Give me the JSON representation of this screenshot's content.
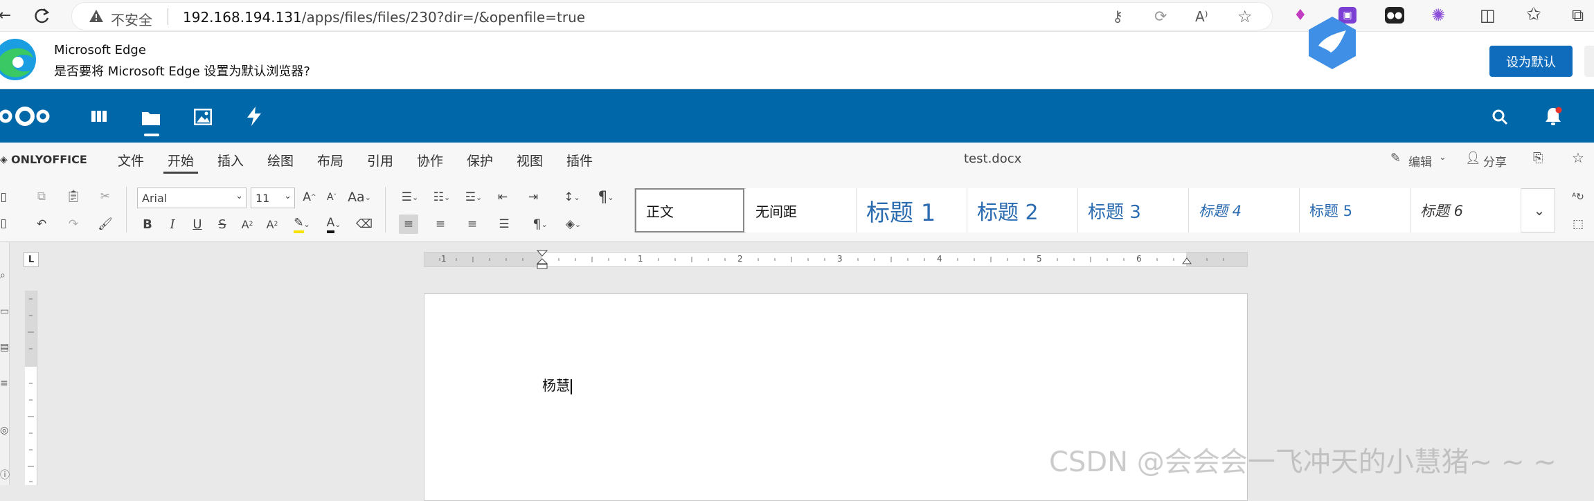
{
  "browser": {
    "insecure_label": "不安全",
    "url_host": "192.168.194.131",
    "url_path": "/apps/files/files/230?dir=/&openfile=true"
  },
  "infobar": {
    "title": "Microsoft Edge",
    "message": "是否要将 Microsoft Edge 设置为默认浏览器?",
    "button": "设为默认"
  },
  "onlyoffice": {
    "brand": "ONLYOFFICE",
    "menu": [
      "文件",
      "开始",
      "插入",
      "绘图",
      "布局",
      "引用",
      "协作",
      "保护",
      "视图",
      "插件"
    ],
    "active_tab": "开始",
    "doc_title": "test.docx",
    "edit_label": "编辑",
    "share_label": "分享"
  },
  "toolbar": {
    "font_name": "Arial",
    "font_size": "11",
    "styles": [
      {
        "label": "正文"
      },
      {
        "label": "无间距"
      },
      {
        "label": "标题 1"
      },
      {
        "label": "标题 2"
      },
      {
        "label": "标题 3"
      },
      {
        "label": "标题 4"
      },
      {
        "label": "标题 5"
      },
      {
        "label": "标题 6"
      }
    ]
  },
  "ruler": {
    "corner_label": "L",
    "numbers": [
      "1",
      "1",
      "2",
      "3",
      "4",
      "5",
      "6"
    ]
  },
  "document": {
    "text": "杨慧"
  },
  "watermark": "CSDN @会会会一飞冲天的小慧猪~ ~ ~",
  "colors": {
    "nextcloud_blue": "#0068a8",
    "edge_button_blue": "#0f6cbd",
    "style_blue": "#2a5a9a"
  }
}
